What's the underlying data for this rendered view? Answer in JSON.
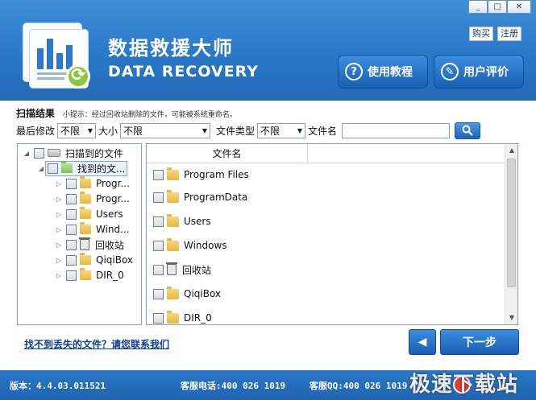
{
  "window": {
    "minimize": "□",
    "maximize": "□",
    "close": "✕"
  },
  "header": {
    "title_cn": "数据救援大师",
    "title_en": "DATA RECOVERY",
    "buy_label": "购买",
    "register_label": "注册",
    "tutorial_label": "使用教程",
    "review_label": "用户评价"
  },
  "scan": {
    "result_label": "扫描结果",
    "tip": "小提示：经过回收站删除的文件，可能被系统重命名。"
  },
  "filters": {
    "modified_label": "最后修改",
    "modified_value": "不限",
    "size_label": "大小",
    "size_value": "不限",
    "type_label": "文件类型",
    "type_value": "不限",
    "name_label": "文件名",
    "name_value": ""
  },
  "tree": {
    "root": "扫描到的文件",
    "found": "找到的文...",
    "items": [
      "Progr...",
      "Progr...",
      "Users",
      "Wind...",
      "回收站",
      "QiqiBox",
      "DIR_0"
    ]
  },
  "list": {
    "column_name": "文件名",
    "items": [
      "Program Files",
      "ProgramData",
      "Users",
      "Windows",
      "回收站",
      "QiqiBox",
      "DIR_0"
    ]
  },
  "actions": {
    "contact_link": "找不到丢失的文件？请您联系我们",
    "back": "◀",
    "next": "下一步"
  },
  "footer": {
    "version": "版本：4.4.03.011521",
    "phone": "客服电话:400 026 1019",
    "qq": "客服QQ:400 026 1019"
  },
  "watermark": "极速下载站",
  "colors": {
    "header_blue": "#2a78c8",
    "button_blue": "#1a5fb3",
    "link_blue": "#0a3d99"
  }
}
